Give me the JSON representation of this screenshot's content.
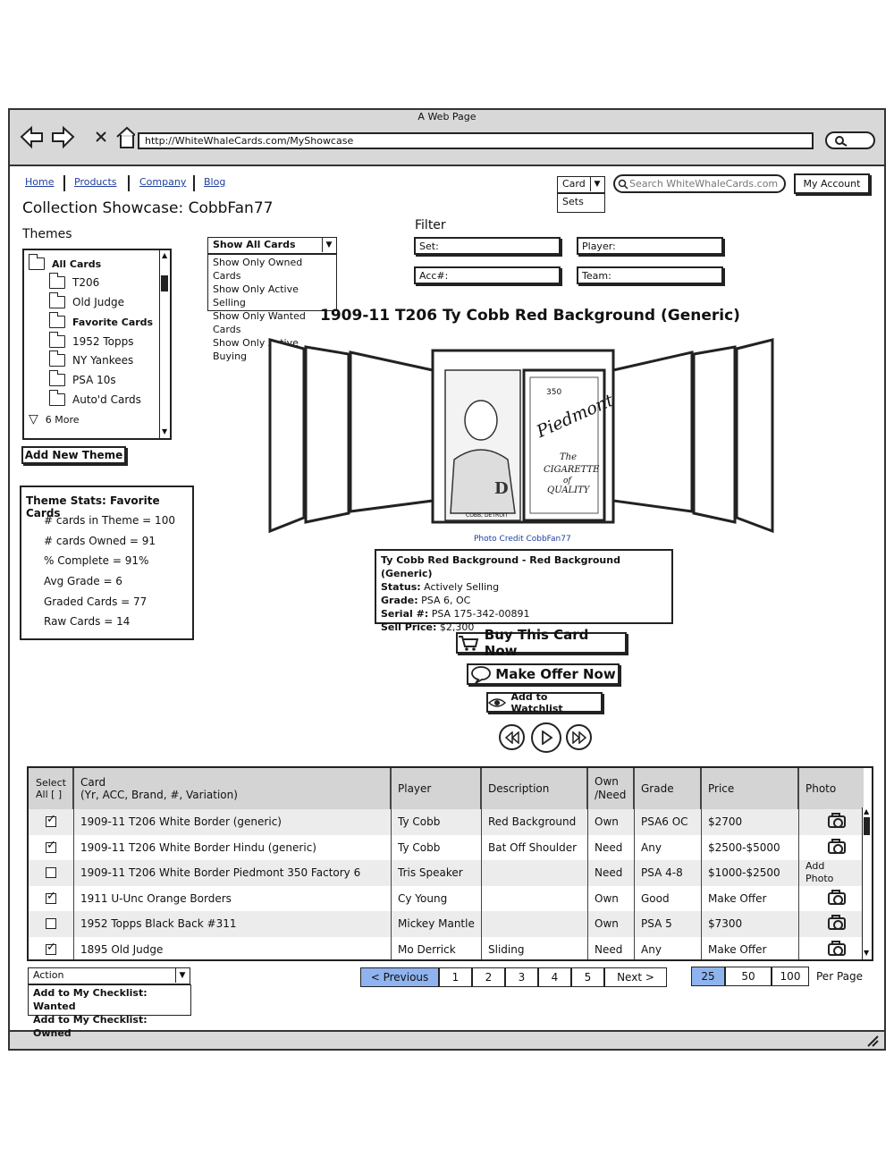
{
  "browser": {
    "window_title": "A Web Page",
    "url": "http://WhiteWhaleCards.com/MyShowcase"
  },
  "nav": {
    "links": [
      "Home",
      "Products",
      "Company",
      "Blog"
    ],
    "search_type": "Card",
    "search_type_option": "Sets",
    "search_placeholder": "Search WhiteWhaleCards.com",
    "account_label": "My Account"
  },
  "page": {
    "title": "Collection Showcase: CobbFan77"
  },
  "themes": {
    "heading": "Themes",
    "items": [
      {
        "label": "All Cards",
        "open": true,
        "bold": true
      },
      {
        "label": "T206"
      },
      {
        "label": "Old Judge"
      },
      {
        "label": "Favorite Cards",
        "open": true,
        "bold": true
      },
      {
        "label": "1952 Topps"
      },
      {
        "label": "NY Yankees"
      },
      {
        "label": "PSA 10s"
      },
      {
        "label": "Auto'd Cards"
      }
    ],
    "more_label": "6 More",
    "add_button": "Add New Theme"
  },
  "show_filter": {
    "selected": "Show All Cards",
    "options": [
      "Show Only Owned Cards",
      "Show Only Active Selling",
      "Show Only Wanted Cards",
      "Show Only Active Buying"
    ]
  },
  "filter": {
    "heading": "Filter",
    "set_placeholder": "Set:",
    "player_placeholder": "Player:",
    "acc_placeholder": "Acc#:",
    "team_placeholder": "Team:"
  },
  "stats": {
    "title": "Theme Stats: Favorite Cards",
    "lines": [
      "# cards in Theme = 100",
      "# cards Owned = 91",
      "% Complete = 91%",
      "Avg Grade = 6",
      "Graded Cards = 77",
      "Raw Cards = 14"
    ]
  },
  "featured": {
    "title": "1909-11 T206 Ty Cobb Red Background (Generic)",
    "photo_credit": "Photo Credit CobbFan77",
    "card_back_text": "Piedmont",
    "card_back_line1": "350",
    "card_back_line2": "The",
    "card_back_line3": "CIGARETTE",
    "card_back_line4": "of",
    "card_back_line5": "QUALITY",
    "card_front_caption": "COBB, DETROIT",
    "info_title": "Ty Cobb Red Background - Red Background (Generic)",
    "status_label": "Status:",
    "status_value": "Actively Selling",
    "grade_label": "Grade:",
    "grade_value": "PSA 6, OC",
    "serial_label": "Serial #:",
    "serial_value": "PSA 175-342-00891",
    "price_label": "Sell Price:",
    "price_value": "$2,300",
    "buy_button": "Buy This Card Now",
    "offer_button": "Make Offer Now",
    "watch_button": "Add to Watchlist"
  },
  "table": {
    "headers": {
      "select": "Select All [ ]",
      "card": "Card",
      "card_sub": "(Yr, ACC, Brand, #, Variation)",
      "player": "Player",
      "description": "Description",
      "own": "Own /Need",
      "grade": "Grade",
      "price": "Price",
      "photo": "Photo"
    },
    "rows": [
      {
        "checked": true,
        "card": "1909-11 T206 White Border (generic)",
        "player": "Ty Cobb",
        "description": "Red Background",
        "own": "Own",
        "grade": "PSA6 OC",
        "price": "$2700",
        "photo": "camera-icon"
      },
      {
        "checked": true,
        "card": "1909-11 T206 White Border Hindu (generic)",
        "player": "Ty Cobb",
        "description": "Bat Off Shoulder",
        "own": "Need",
        "grade": "Any",
        "price": "$2500-$5000",
        "photo": "camera-icon"
      },
      {
        "checked": false,
        "card": " 1909-11 T206 White Border Piedmont 350 Factory 6",
        "player": "Tris Speaker",
        "description": "",
        "own": "Need",
        "grade": "PSA 4-8",
        "price": "$1000-$2500",
        "photo": "Add Photo"
      },
      {
        "checked": true,
        "card": "1911 U-Unc Orange Borders",
        "player": "Cy Young",
        "description": "",
        "own": "Own",
        "grade": "Good",
        "price": "Make Offer",
        "photo": "camera-icon"
      },
      {
        "checked": false,
        "card": "1952 Topps Black Back #311",
        "player": "Mickey Mantle",
        "description": "",
        "own": "Own",
        "grade": "PSA 5",
        "price": "$7300",
        "photo": "camera-icon"
      },
      {
        "checked": true,
        "card": "1895 Old Judge",
        "player": "Mo Derrick",
        "description": "Sliding",
        "own": "Need",
        "grade": "Any",
        "price": "Make Offer",
        "photo": "camera-icon"
      }
    ]
  },
  "actions": {
    "selected": "Action",
    "options": [
      "Add to My Checklist: Wanted",
      "Add to My Checklist: Owned"
    ]
  },
  "pagination": {
    "previous": "< Previous",
    "pages": [
      "1",
      "2",
      "3",
      "4",
      "5"
    ],
    "next": "Next >",
    "per_page_options": [
      "25",
      "50",
      "100"
    ],
    "per_page_selected": "25",
    "per_page_label": "Per Page"
  }
}
